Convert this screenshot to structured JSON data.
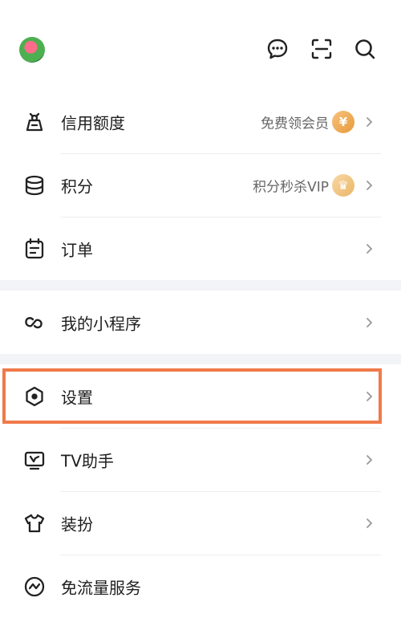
{
  "header": {
    "icons": [
      "messages-icon",
      "scan-icon",
      "search-icon"
    ]
  },
  "menu_group_1": [
    {
      "label": "信用额度",
      "note": "免费领会员",
      "badge": "¥",
      "icon": "credit-icon"
    },
    {
      "label": "积分",
      "note": "积分秒杀VIP",
      "badge": "♛",
      "icon": "points-icon"
    },
    {
      "label": "订单",
      "icon": "order-icon"
    }
  ],
  "menu_group_2": [
    {
      "label": "我的小程序",
      "icon": "miniprogram-icon"
    }
  ],
  "menu_group_3": [
    {
      "label": "设置",
      "icon": "settings-icon"
    },
    {
      "label": "TV助手",
      "icon": "tv-icon"
    },
    {
      "label": "装扮",
      "icon": "shirt-icon"
    },
    {
      "label": "免流量服务",
      "icon": "flow-icon"
    }
  ],
  "colors": {
    "highlight": "#f07a4a",
    "badge": "#e79a3c",
    "separator": "#f3f4f7"
  }
}
